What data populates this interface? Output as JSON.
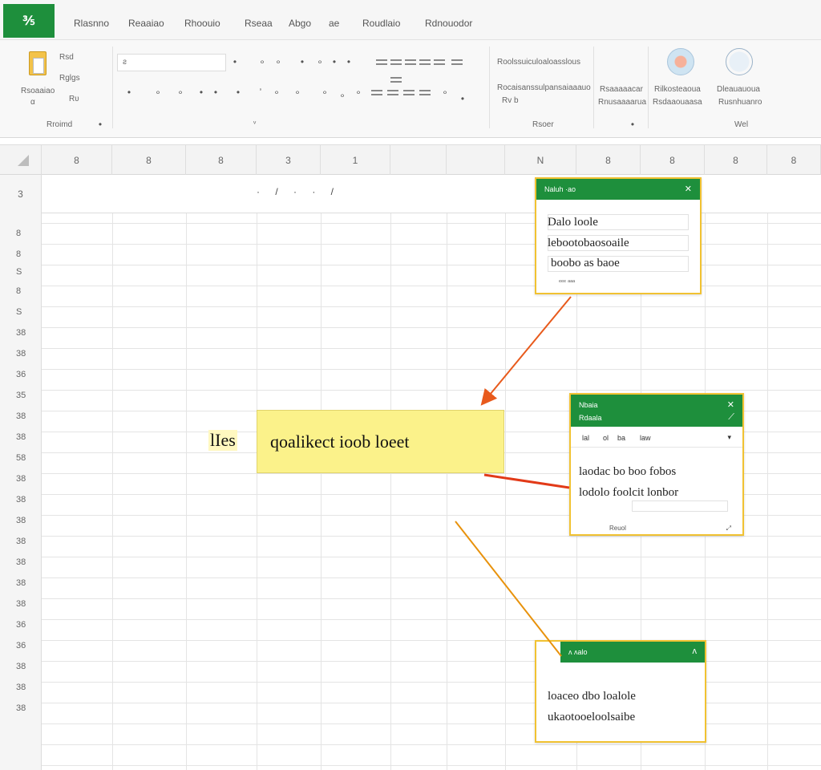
{
  "app": {
    "logo": "⅗"
  },
  "tabs": [
    "Rlasnno",
    "Reaaiao",
    "Rhoouio",
    "Rseaa",
    "Abgo",
    "ae",
    "Roudlaio",
    "Rdnouodor"
  ],
  "ribbon": {
    "font_name": "ƨ",
    "clipboard_label": "Rsoaaiao",
    "clipboard_sub": "α",
    "clipboard_items": [
      "Rsd",
      "Rglgs",
      "Rʋ"
    ],
    "group_clipboard": "Rroimd",
    "group_font_marker": "ᵥ",
    "styles_line1": "Roolssuiculoaloasslous",
    "styles_line2": "Rocaisanssulpansaiaaauo",
    "styles_sub": "Rv b",
    "group_styles": "Rsoer",
    "cells_line1": "Rsaaaaacar",
    "cells_line2": "Rnusaaaarua",
    "group_cells": "",
    "net_line1": "Rilkosteaoua",
    "net_line2": "Rsdaaouaasa",
    "globe_line1": "Dleauauoua",
    "globe_line2": "Rusnhuanro",
    "group_web": "Wel"
  },
  "columns": [
    "8",
    "8",
    "8",
    "3",
    "1",
    "",
    "",
    "N",
    "8",
    "8",
    "8",
    "8"
  ],
  "formula_bar": {
    "row_label": "3",
    "content": "· / · · /"
  },
  "rows": [
    "8",
    "8",
    "S",
    "8",
    "S",
    "38",
    "38",
    "36",
    "35",
    "38",
    "38",
    "58",
    "38",
    "38",
    "38",
    "38",
    "38",
    "38",
    "38",
    "36",
    "36",
    "38",
    "38",
    "38"
  ],
  "highlight": {
    "prefix": "lIes",
    "text": "qoalikect ioob loeet"
  },
  "popups": [
    {
      "title": "Naluh ·ao",
      "lines": [
        "Dalo loole",
        "lebootobaosoaile",
        "boobo as baoe"
      ],
      "footer": "ᵉᵉᵉ ᵃᵃᵃ"
    },
    {
      "title": "Nbaia",
      "subtitle": "Rdaala",
      "toolbar": [
        "lal",
        "ol",
        "ba",
        "law"
      ],
      "lines": [
        "laodac bo boo fobos",
        "lodolo foolcit lonbor"
      ],
      "footer": "Reuol"
    },
    {
      "title": "ʌ ʌalo",
      "lines": [
        "loaceo dbo loalole",
        "ukaotooeloolsaibe"
      ]
    }
  ],
  "colors": {
    "accent_green": "#1e8f3c",
    "highlight_yellow": "#fbf28a",
    "popup_border": "#f1c232",
    "arrow_orange": "#e85a1c"
  }
}
